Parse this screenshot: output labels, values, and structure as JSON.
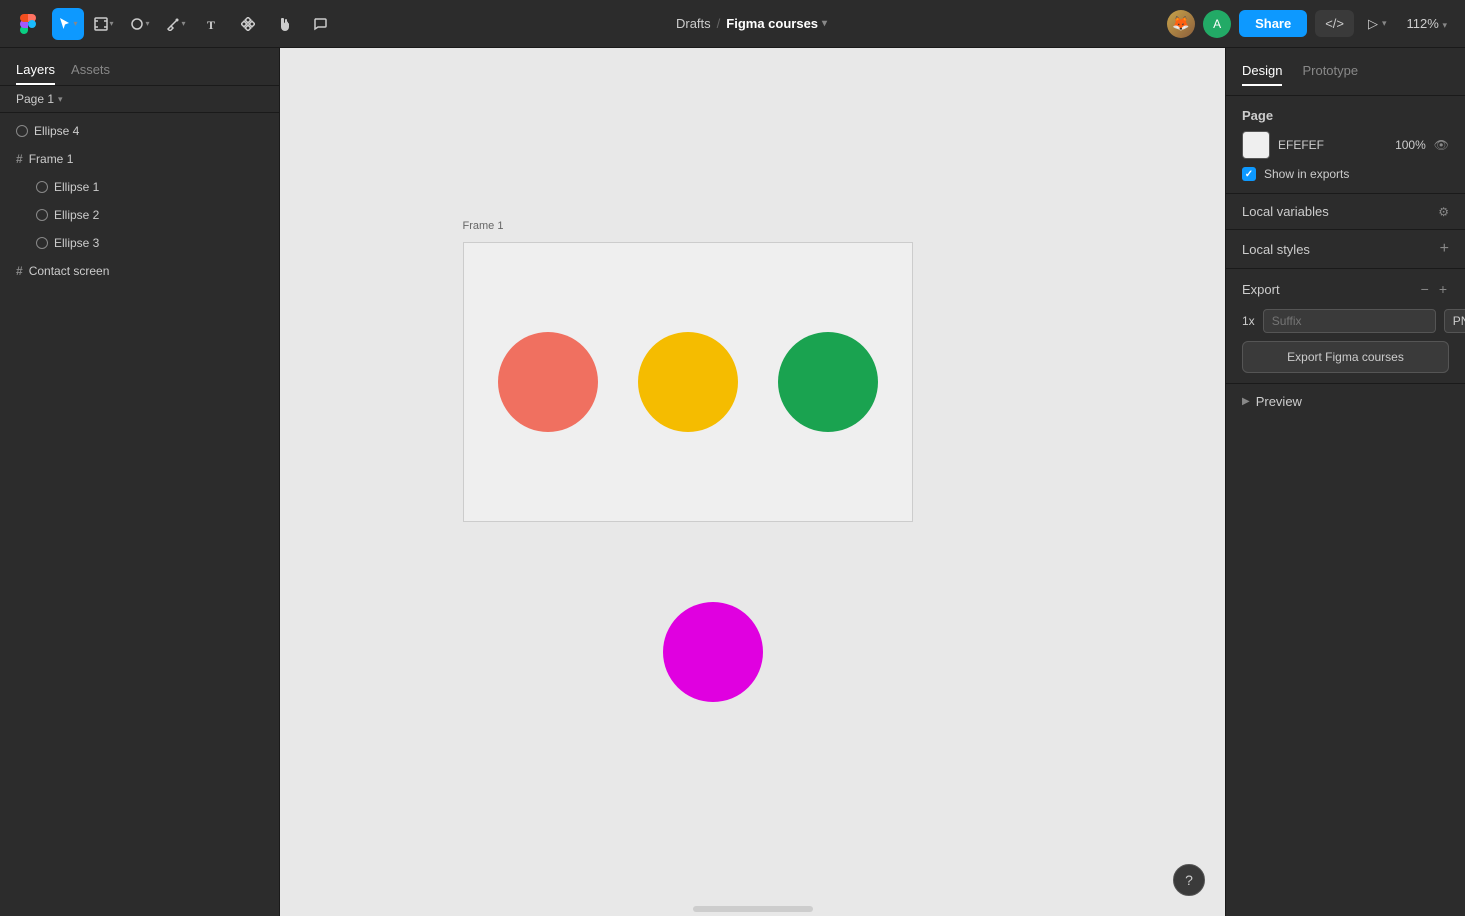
{
  "toolbar": {
    "logo": "🎨",
    "breadcrumb": {
      "drafts": "Drafts",
      "separator": "/",
      "project": "Figma courses",
      "arrow": "▾"
    },
    "share_label": "Share",
    "code_label": "</>",
    "play_label": "▷",
    "play_arrow": "▾",
    "zoom_label": "112%",
    "zoom_arrow": "▾"
  },
  "left_sidebar": {
    "tab_layers": "Layers",
    "tab_assets": "Assets",
    "page_label": "Page 1",
    "page_arrow": "▾",
    "layers": [
      {
        "id": "ellipse4",
        "name": "Ellipse 4",
        "icon": "ellipse",
        "indent": 0
      },
      {
        "id": "frame1",
        "name": "Frame 1",
        "icon": "frame",
        "indent": 0
      },
      {
        "id": "ellipse1",
        "name": "Ellipse 1",
        "icon": "ellipse",
        "indent": 1
      },
      {
        "id": "ellipse2",
        "name": "Ellipse 2",
        "icon": "ellipse",
        "indent": 1
      },
      {
        "id": "ellipse3",
        "name": "Ellipse 3",
        "icon": "ellipse",
        "indent": 1
      },
      {
        "id": "contact_screen",
        "name": "Contact screen",
        "icon": "frame",
        "indent": 0
      }
    ]
  },
  "canvas": {
    "frame_label": "Frame 1",
    "background": "#e8e8e8",
    "frame_bg": "#efefef",
    "circles": [
      {
        "id": "ellipse1",
        "color": "#f07060",
        "size": 100
      },
      {
        "id": "ellipse2",
        "color": "#f5bc00",
        "size": 100
      },
      {
        "id": "ellipse3",
        "color": "#1aa350",
        "size": 100
      }
    ],
    "ellipse4": {
      "color": "#e000e0",
      "size": 100
    }
  },
  "right_sidebar": {
    "tab_design": "Design",
    "tab_prototype": "Prototype",
    "page_section_label": "Page",
    "color_hex": "EFEFEF",
    "color_opacity": "100%",
    "show_exports_label": "Show in exports",
    "local_variables_label": "Local variables",
    "local_styles_label": "Local styles",
    "export_label": "Export",
    "export_scale": "1x",
    "export_suffix_placeholder": "Suffix",
    "export_format": "PNG",
    "export_format_arrow": "▾",
    "export_button_label": "Export Figma courses",
    "preview_label": "Preview",
    "preview_arrow": "▶"
  },
  "help": "?"
}
